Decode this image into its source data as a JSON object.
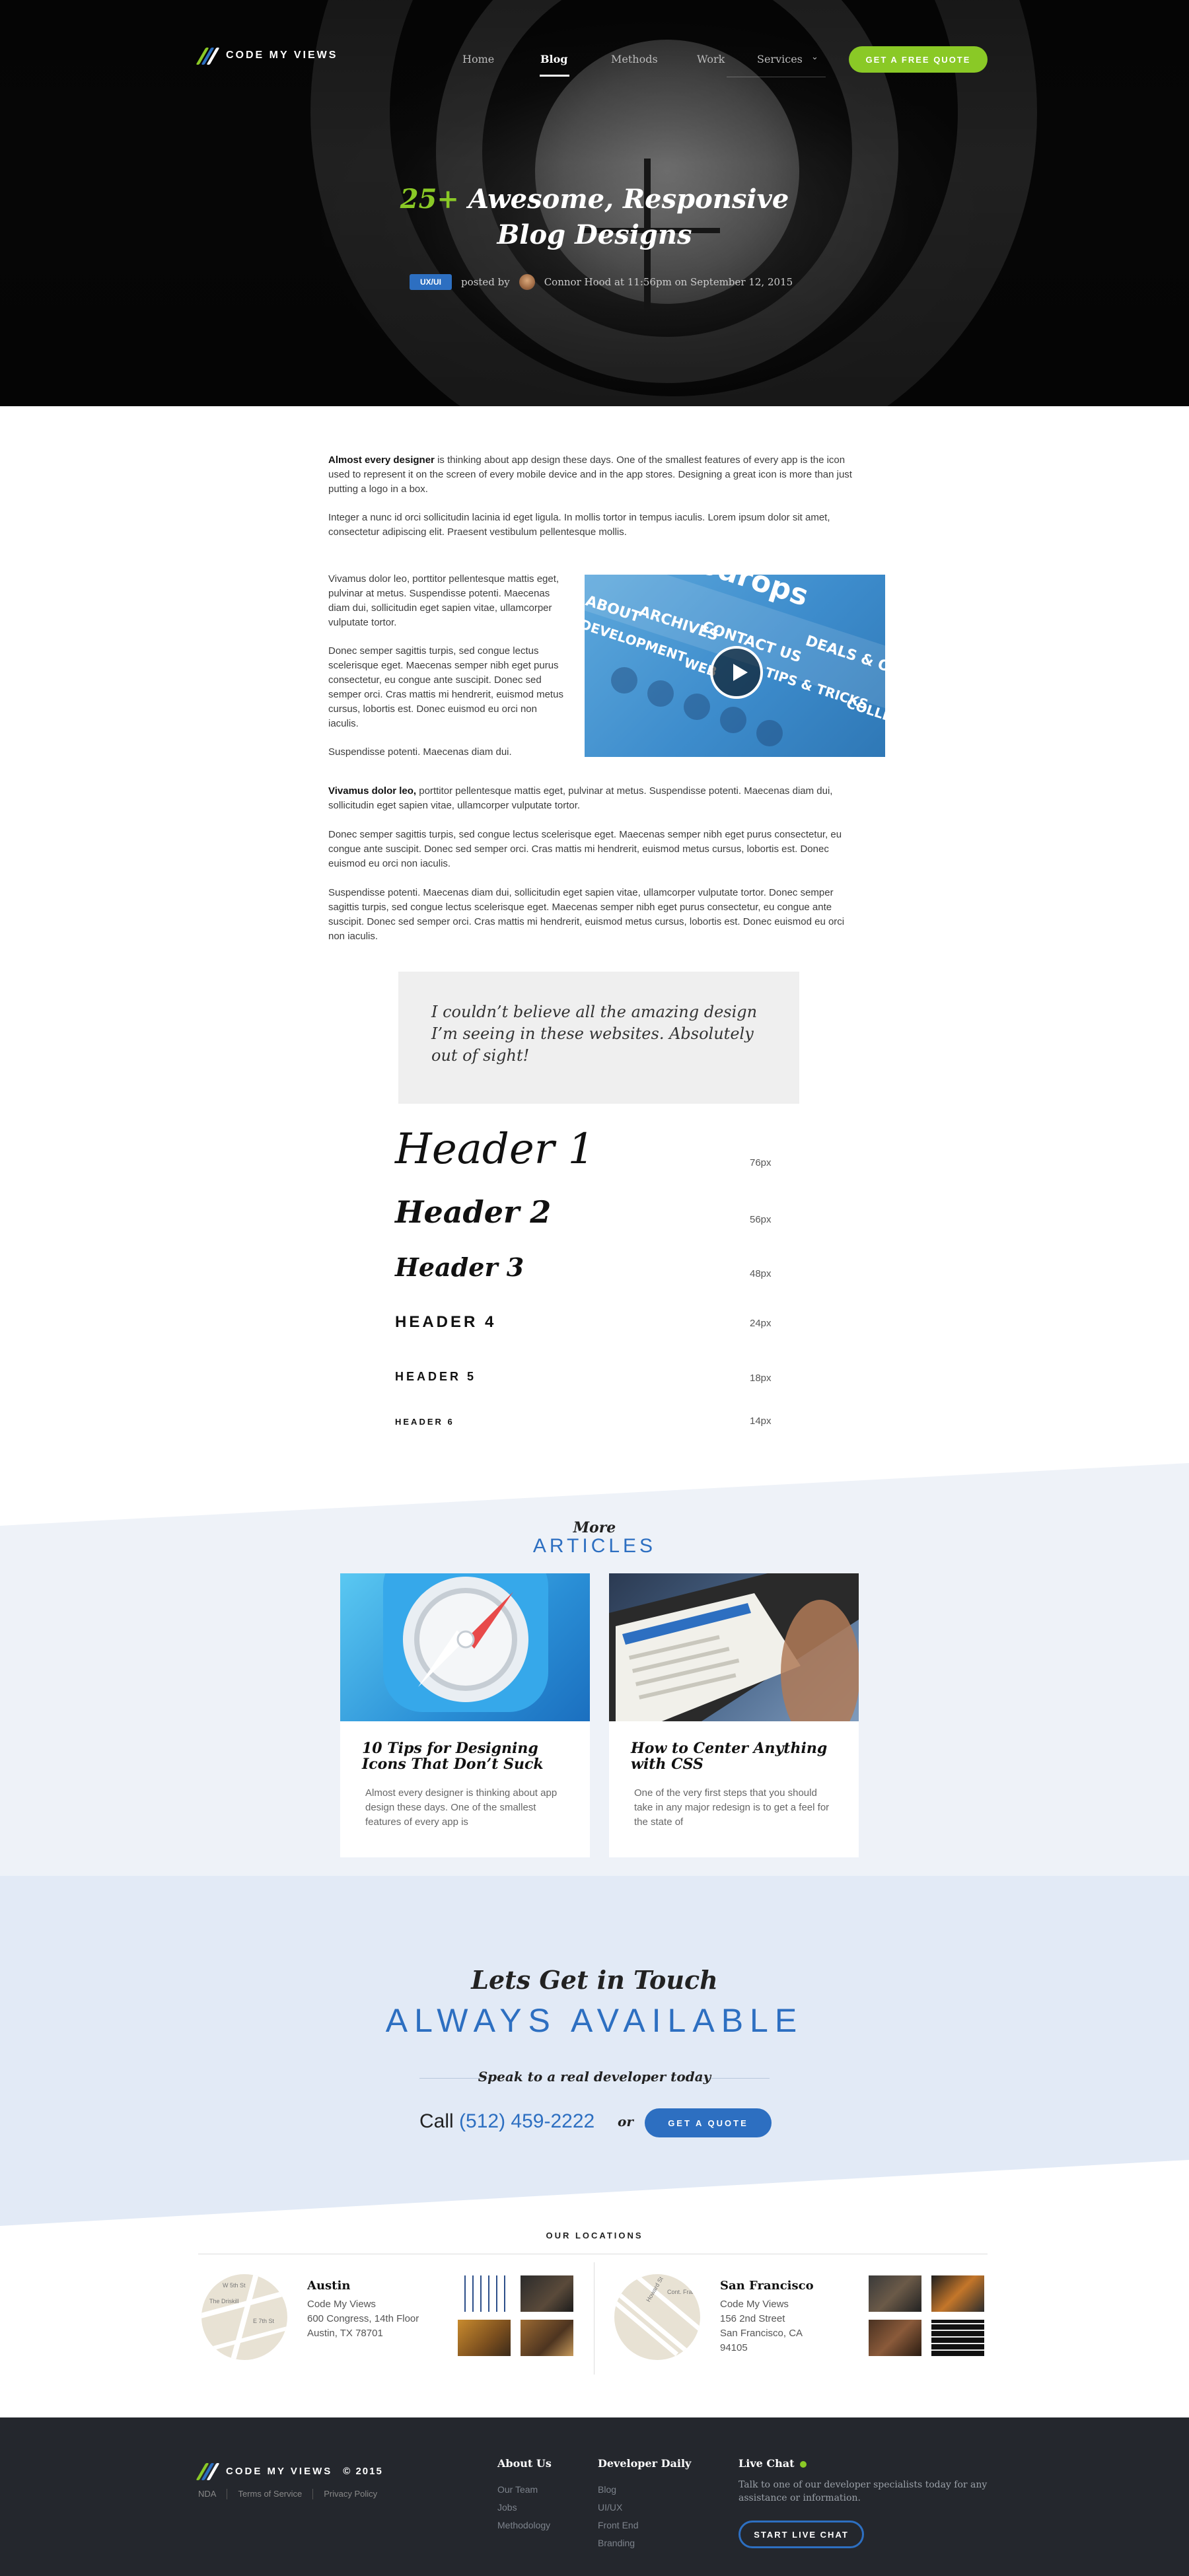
{
  "brand": {
    "name": "CODE MY VIEWS",
    "accent": "#8ac926",
    "blue": "#2d6fc1"
  },
  "nav": {
    "items": [
      "Home",
      "Blog",
      "Methods",
      "Work",
      "Services"
    ],
    "cta": "GET A FREE QUOTE"
  },
  "hero": {
    "title_accent": "25+",
    "title_line1": " Awesome, Responsive",
    "title_line2": "Blog Designs",
    "tag": "UX/UI",
    "posted_by": "posted by",
    "author_line": "Connor Hood at 11:56pm on September 12, 2015"
  },
  "article": {
    "p1_bold": "Almost every designer",
    "p1_rest": " is thinking about app design these days. One of the smallest features of every app is the icon used to represent it on the screen of every mobile device and in the app stores. Designing a great icon is more than just putting a logo in a box.",
    "p2": "Integer a nunc id orci sollicitudin lacinia id eget ligula. In mollis tortor in tempus iaculis. Lorem ipsum dolor sit amet, consectetur adipiscing elit. Praesent vestibulum pellentesque mollis.",
    "side_p1": "Vivamus dolor leo, porttitor pellentesque mattis eget, pulvinar at metus. Suspendisse potenti. Maecenas diam dui, sollicitudin eget sapien vitae, ullamcorper vulputate tortor.",
    "side_p2": "Donec semper sagittis turpis, sed congue lectus scelerisque eget. Maecenas semper nibh eget purus consectetur, eu congue ante suscipit. Donec sed semper orci. Cras mattis mi hendrerit, euismod metus cursus, lobortis est. Donec euismod eu orci non iaculis.",
    "side_p3": "Suspendisse potenti. Maecenas diam dui.",
    "video_words": [
      "ABOUT",
      "ARCHIVES",
      "CONTACT US",
      "DEALS & OFFERS",
      "DEVELOPMENT",
      "WEB",
      "TIPS & TRICKS",
      "COLLEC"
    ],
    "video_logo": "odrops",
    "p3_bold": "Vivamus dolor leo,",
    "p3_rest": " porttitor pellentesque mattis eget, pulvinar at metus. Suspendisse potenti. Maecenas diam dui, sollicitudin eget sapien vitae, ullamcorper vulputate tortor.",
    "p4": "Donec semper sagittis turpis, sed congue lectus scelerisque eget. Maecenas semper nibh eget purus consectetur, eu congue ante suscipit. Donec sed semper orci. Cras mattis mi hendrerit, euismod metus cursus, lobortis est. Donec euismod eu orci non iaculis.",
    "p5": "Suspendisse potenti. Maecenas diam dui, sollicitudin eget sapien vitae, ullamcorper vulputate tortor. Donec semper sagittis turpis, sed congue lectus scelerisque eget. Maecenas semper nibh eget purus consectetur, eu congue ante suscipit. Donec sed semper orci. Cras mattis mi hendrerit, euismod metus cursus, lobortis est. Donec euismod eu orci non iaculis.",
    "quote": "I couldn’t believe all the amazing design I’m seeing in these websites. Absolutely out of sight!"
  },
  "headers": [
    {
      "label": "Header 1",
      "size": "76px"
    },
    {
      "label": "Header 2",
      "size": "56px"
    },
    {
      "label": "Header 3",
      "size": "48px"
    },
    {
      "label": "HEADER 4",
      "size": "24px"
    },
    {
      "label": "HEADER 5",
      "size": "18px"
    },
    {
      "label": "HEADER 6",
      "size": "14px"
    }
  ],
  "more": {
    "kicker": "More",
    "title": "ARTICLES",
    "cards": [
      {
        "title": "10 Tips for Designing Icons That Don’t Suck",
        "excerpt": "Almost every designer is thinking about app design these days. One of the smallest features of every app is"
      },
      {
        "title": "How to Center Anything with CSS",
        "excerpt": "One of the very first steps that you should take in any major redesign is to get a feel for the state of"
      }
    ]
  },
  "contact": {
    "line1": "Lets Get in Touch",
    "line2": "ALWAYS AVAILABLE",
    "line3": "Speak to a real developer today",
    "call_label": "Call",
    "phone": "(512) 459-2222",
    "or": "or",
    "button": "GET A QUOTE"
  },
  "locations": {
    "title": "OUR LOCATIONS",
    "offices": [
      {
        "city": "Austin",
        "lines": [
          "Code My Views",
          "600 Congress, 14th Floor",
          "Austin, TX 78701"
        ],
        "map_labels": [
          "W 5th St",
          "The Driskill",
          "E 7th St"
        ]
      },
      {
        "city": "San Francisco",
        "lines": [
          "Code My Views",
          "156 2nd Street",
          "San Francisco, CA 94105"
        ],
        "map_labels": [
          "Howard St",
          "Cont. Francisco"
        ]
      }
    ]
  },
  "footer": {
    "brand": "CODE MY VIEWS",
    "copyright": "© 2015",
    "links": [
      "NDA",
      "Terms of Service",
      "Privacy Policy"
    ],
    "about_title": "About Us",
    "about_items": [
      "Our Team",
      "Jobs",
      "Methodology"
    ],
    "dev_title": "Developer Daily",
    "dev_items": [
      "Blog",
      "UI/UX",
      "Front End",
      "Branding"
    ],
    "chat_title": "Live Chat",
    "chat_text": "Talk to one of our developer specialists today for any assistance or information.",
    "chat_button": "START LIVE CHAT"
  }
}
